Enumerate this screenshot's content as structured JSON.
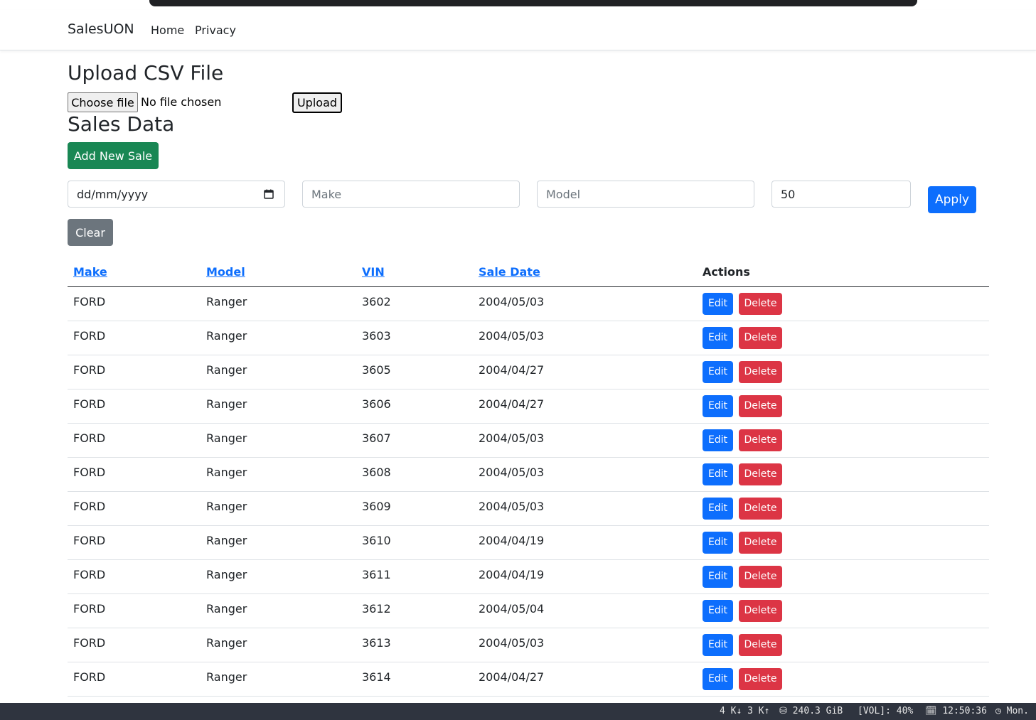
{
  "navbar": {
    "brand": "SalesUON",
    "links": [
      "Home",
      "Privacy"
    ]
  },
  "upload": {
    "title": "Upload CSV File",
    "choose_label": "Choose file",
    "file_status": "No file chosen",
    "upload_label": "Upload"
  },
  "sales": {
    "title": "Sales Data",
    "add_label": "Add New Sale"
  },
  "filters": {
    "date_placeholder": "dd/mm/yyyy",
    "make_placeholder": "Make",
    "model_placeholder": "Model",
    "page_size": "50",
    "apply_label": "Apply",
    "clear_label": "Clear"
  },
  "table": {
    "headers": [
      "Make",
      "Model",
      "VIN",
      "Sale Date",
      "Actions"
    ],
    "edit_label": "Edit",
    "delete_label": "Delete",
    "rows": [
      [
        "FORD",
        "Ranger",
        "3602",
        "2004/05/03"
      ],
      [
        "FORD",
        "Ranger",
        "3603",
        "2004/05/03"
      ],
      [
        "FORD",
        "Ranger",
        "3605",
        "2004/04/27"
      ],
      [
        "FORD",
        "Ranger",
        "3606",
        "2004/04/27"
      ],
      [
        "FORD",
        "Ranger",
        "3607",
        "2004/05/03"
      ],
      [
        "FORD",
        "Ranger",
        "3608",
        "2004/05/03"
      ],
      [
        "FORD",
        "Ranger",
        "3609",
        "2004/05/03"
      ],
      [
        "FORD",
        "Ranger",
        "3610",
        "2004/04/19"
      ],
      [
        "FORD",
        "Ranger",
        "3611",
        "2004/04/19"
      ],
      [
        "FORD",
        "Ranger",
        "3612",
        "2004/05/04"
      ],
      [
        "FORD",
        "Ranger",
        "3613",
        "2004/05/03"
      ],
      [
        "FORD",
        "Ranger",
        "3614",
        "2004/04/27"
      ]
    ]
  },
  "statusbar": {
    "network": "4 K↓ 3 K↑",
    "disk": "⛁ 240.3 GiB",
    "volume": "[VOL]: 40%",
    "time": "🗓 12:50:36",
    "day": "◷ Mon."
  },
  "colors": {
    "primary": "#0d6efd",
    "success": "#198754",
    "secondary": "#6c757d",
    "danger": "#dc3545",
    "statusbar_bg": "#2f343f"
  }
}
